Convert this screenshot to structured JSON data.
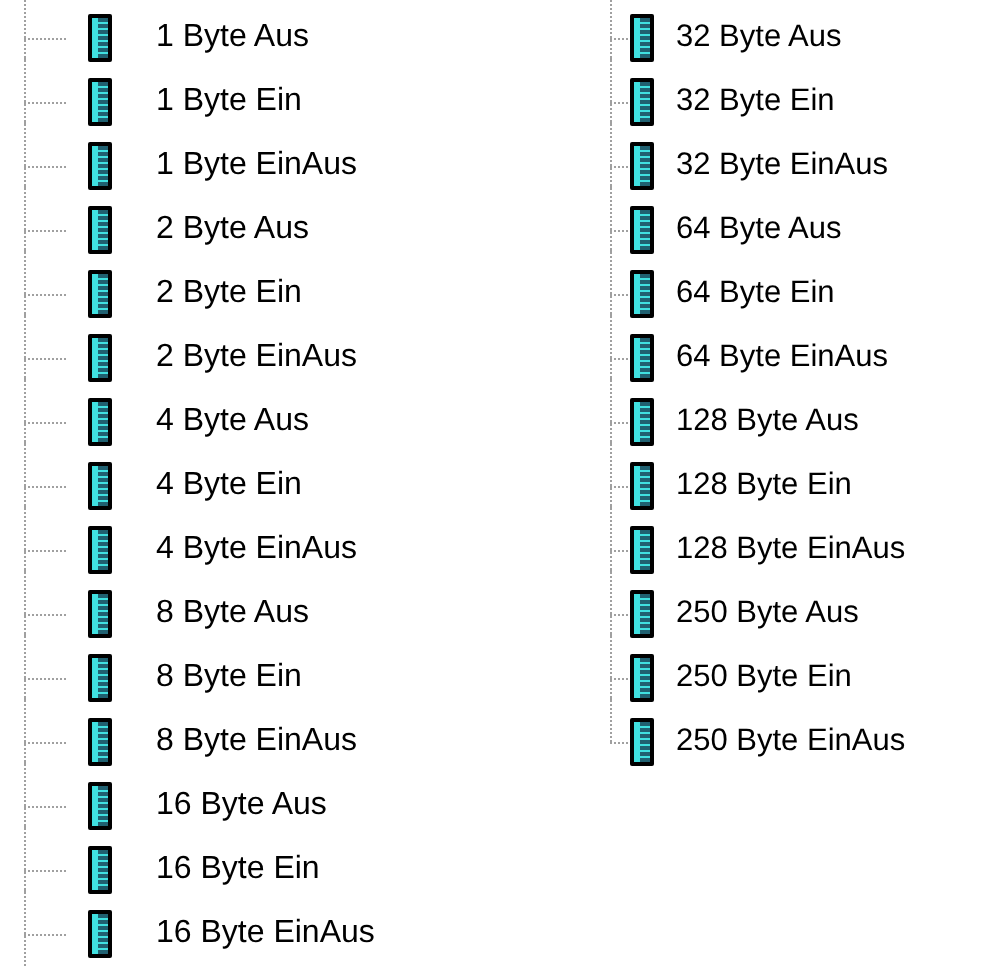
{
  "columns": [
    {
      "items": [
        "1 Byte Aus",
        "1 Byte Ein",
        "1 Byte EinAus",
        "2 Byte Aus",
        "2 Byte Ein",
        "2 Byte EinAus",
        "4 Byte Aus",
        "4 Byte Ein",
        "4 Byte EinAus",
        "8 Byte Aus",
        "8 Byte Ein",
        "8 Byte EinAus",
        "16 Byte Aus",
        "16 Byte Ein",
        "16 Byte EinAus"
      ]
    },
    {
      "items": [
        "32 Byte Aus",
        "32 Byte Ein",
        "32 Byte EinAus",
        "64 Byte Aus",
        "64 Byte Ein",
        "64 Byte EinAus",
        "128 Byte Aus",
        "128 Byte Ein",
        "128 Byte EinAus",
        "250 Byte Aus",
        "250 Byte Ein",
        "250 Byte EinAus"
      ]
    }
  ]
}
